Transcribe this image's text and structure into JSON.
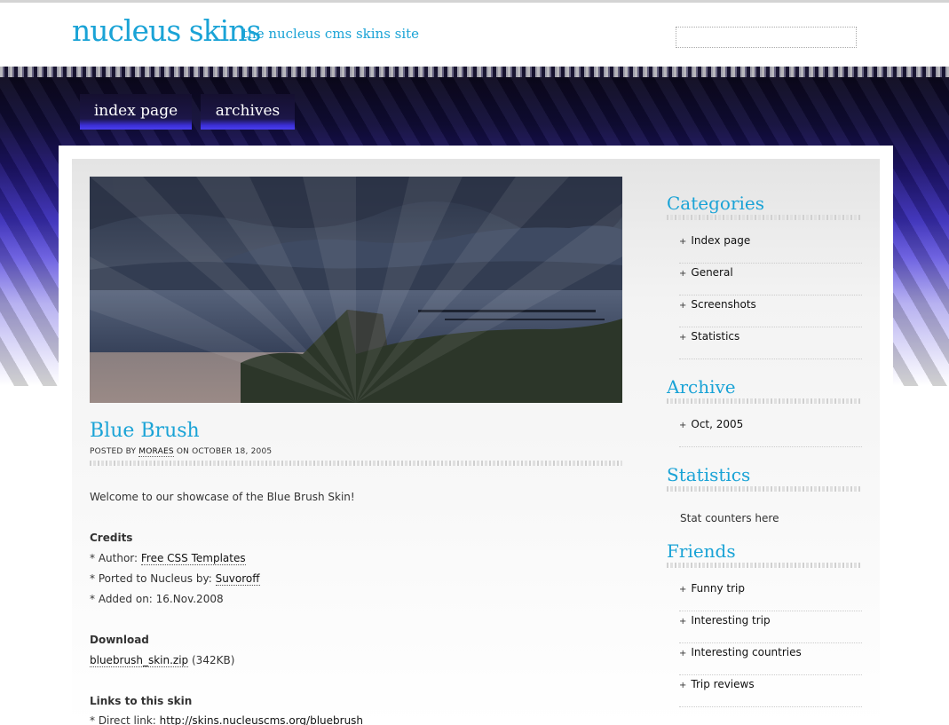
{
  "header": {
    "site_title": "nucleus skins",
    "tagline": "the nucleus cms skins site",
    "search_placeholder": ""
  },
  "nav": {
    "tabs": [
      {
        "label": "index page"
      },
      {
        "label": "archives"
      }
    ]
  },
  "post": {
    "title": "Blue Brush",
    "meta_prefix": "POSTED BY",
    "author": "MORAES",
    "meta_date": "ON OCTOBER 18, 2005",
    "intro": "Welcome to our showcase of the Blue Brush Skin!",
    "credits_heading": "Credits",
    "author_label": "* Author:",
    "author_link": "Free CSS Templates",
    "ported_label": "* Ported to Nucleus by:",
    "ported_link": "Suvoroff",
    "added_on": "* Added on: 16.Nov.2008",
    "download_heading": "Download",
    "download_link": "bluebrush_skin.zip",
    "download_size": "(342KB)",
    "links_heading": "Links to this skin",
    "direct_label": "* Direct link:",
    "direct_link": "http://skins.nucleuscms.org/bluebrush"
  },
  "sidebar": {
    "categories_heading": "Categories",
    "categories": [
      "Index page",
      "General",
      "Screenshots",
      "Statistics"
    ],
    "archive_heading": "Archive",
    "archive": [
      "Oct, 2005"
    ],
    "statistics_heading": "Statistics",
    "statistics_text": "Stat counters here",
    "friends_heading": "Friends",
    "friends": [
      "Funny trip",
      "Interesting trip",
      "Interesting countries",
      "Trip reviews"
    ]
  },
  "colors": {
    "accent": "#1aa3d6",
    "nav_blue": "#3b2fd6"
  }
}
